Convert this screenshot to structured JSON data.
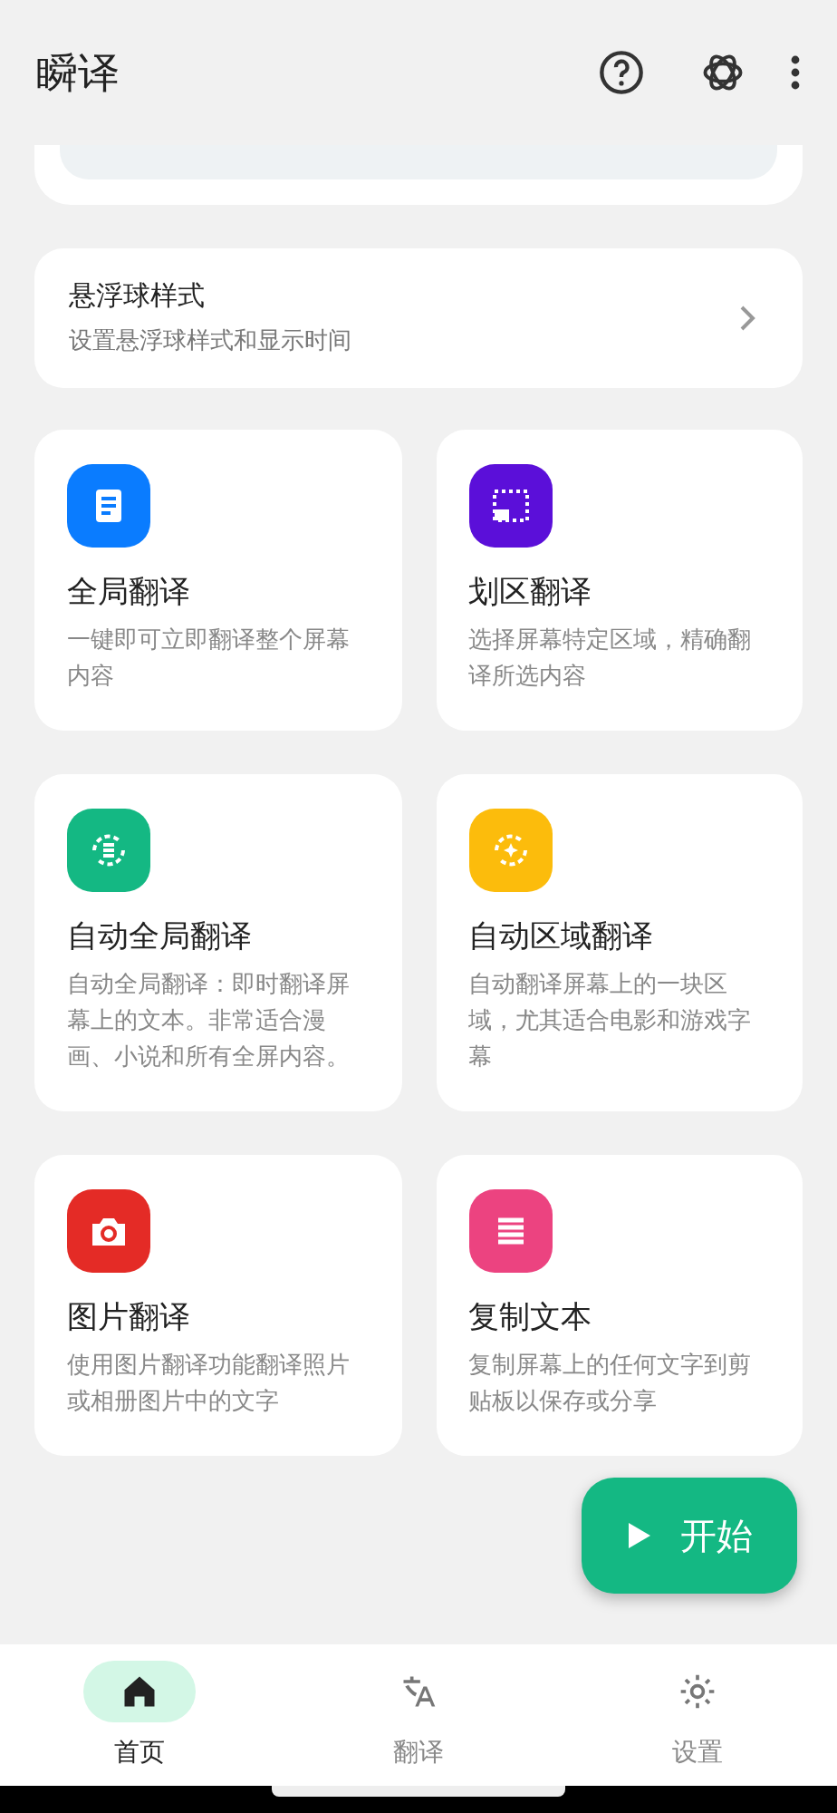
{
  "app_bar": {
    "title": "瞬译"
  },
  "floating_ball_setting": {
    "title": "悬浮球样式",
    "subtitle": "设置悬浮球样式和显示时间"
  },
  "features": [
    {
      "kind": "document",
      "color": "#0a7cff",
      "title": "全局翻译",
      "description": "一键即可立即翻译整个屏幕内容"
    },
    {
      "kind": "region",
      "color": "#5b0fd9",
      "title": "划区翻译",
      "description": "选择屏幕特定区域，精确翻译所选内容"
    },
    {
      "kind": "auto-full",
      "color": "#14b883",
      "title": "自动全局翻译",
      "description": "自动全局翻译：即时翻译屏幕上的文本。非常适合漫画、小说和所有全屏内容。"
    },
    {
      "kind": "auto-region",
      "color": "#fcbc0c",
      "title": "自动区域翻译",
      "description": "自动翻译屏幕上的一块区域，尤其适合电影和游戏字幕"
    },
    {
      "kind": "camera",
      "color": "#e42b26",
      "title": "图片翻译",
      "description": "使用图片翻译功能翻译照片或相册图片中的文字"
    },
    {
      "kind": "copy",
      "color": "#ec4380",
      "title": "复制文本",
      "description": "复制屏幕上的任何文字到剪贴板以保存或分享"
    }
  ],
  "start_button": {
    "label": "开始"
  },
  "bottom_nav": [
    {
      "kind": "home",
      "label": "首页",
      "selected": true
    },
    {
      "kind": "translate",
      "label": "翻译",
      "selected": false
    },
    {
      "kind": "settings",
      "label": "设置",
      "selected": false
    }
  ]
}
